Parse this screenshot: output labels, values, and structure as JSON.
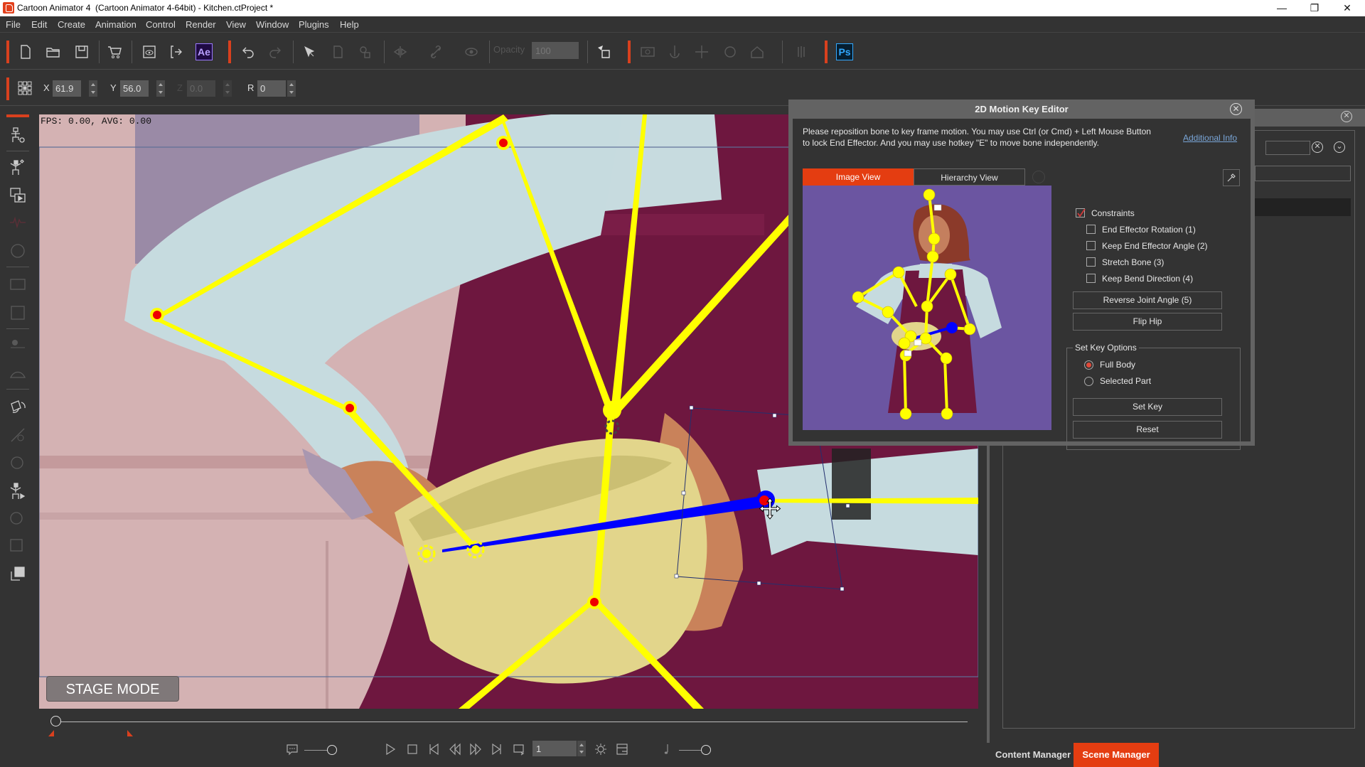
{
  "window": {
    "title": "Cartoon Animator 4  (Cartoon Animator 4-64bit) - Kitchen.ctProject *",
    "controls": {
      "minimize": "—",
      "maximize": "❐",
      "close": "✕"
    }
  },
  "menu": [
    "File",
    "Edit",
    "Create",
    "Animation",
    "Control",
    "Render",
    "View",
    "Window",
    "Plugins",
    "Help"
  ],
  "toolbar": {
    "tools": [
      "new-file",
      "open-folder",
      "save",
      "content-store",
      "preview-render",
      "export",
      "after-effects",
      "undo",
      "redo",
      "select",
      "duplicate",
      "group",
      "flip",
      "link",
      "visibility",
      "opacity",
      "reset-pivot",
      "camera",
      "puppet",
      "move",
      "rotate",
      "morph",
      "align",
      "photoshop"
    ],
    "ae_label": "Ae",
    "ps_label": "Ps",
    "opacity_label": "Opacity",
    "opacity_value": "100"
  },
  "transform": {
    "x_label": "X",
    "x_value": "61.9",
    "y_label": "Y",
    "y_value": "56.0",
    "z_label": "Z",
    "z_value": "0.0",
    "r_label": "R",
    "r_value": "0"
  },
  "sidebar": {
    "items": [
      "character-composer",
      "bone-editor",
      "scene-editor",
      "audio-lipsync",
      "face-key",
      "sprite-editor",
      "prop-editor",
      "3d-head",
      "spring-editor",
      "motion-key-editor",
      "elastic-editor",
      "face-puppet",
      "motion-puppet",
      "head-turn",
      "sprite-switch",
      "layer-manager"
    ]
  },
  "canvas": {
    "fps_text": "FPS: 0.00, AVG: 0.00",
    "stage_mode_label": "STAGE MODE"
  },
  "timeline": {
    "current_frame": "1",
    "playhead_fraction": 0.0
  },
  "dialog": {
    "title": "2D Motion Key Editor",
    "instructions": "Please reposition bone to key frame motion. You may use Ctrl (or Cmd) + Left Mouse Button to lock End Effector. And you may use hotkey \"E\" to move bone independently.",
    "additional_info_link": "Additional Info",
    "tabs": [
      {
        "label": "Image View",
        "active": true
      },
      {
        "label": "Hierarchy View",
        "active": false
      }
    ],
    "constraints": {
      "label": "Constraints",
      "checked": true,
      "options": [
        {
          "label": "End Effector Rotation (1)",
          "checked": false
        },
        {
          "label": "Keep End Effector Angle (2)",
          "checked": false
        },
        {
          "label": "Stretch Bone (3)",
          "checked": false
        },
        {
          "label": "Keep Bend Direction (4)",
          "checked": false
        }
      ]
    },
    "buttons": {
      "reverse_joint": "Reverse Joint Angle (5)",
      "flip_hip": "Flip Hip",
      "set_key": "Set Key",
      "reset": "Reset"
    },
    "set_key_options": {
      "title": "Set Key Options",
      "options": [
        {
          "label": "Full Body",
          "selected": true
        },
        {
          "label": "Selected Part",
          "selected": false
        }
      ]
    }
  },
  "bottom_tabs": [
    {
      "label": "Content Manager",
      "active": false
    },
    {
      "label": "Scene Manager",
      "active": true
    }
  ],
  "colors": {
    "accent": "#e43d11",
    "bone": "#ffff00",
    "selected_bone": "#0000ff",
    "preview_bg": "#6b55a1"
  }
}
